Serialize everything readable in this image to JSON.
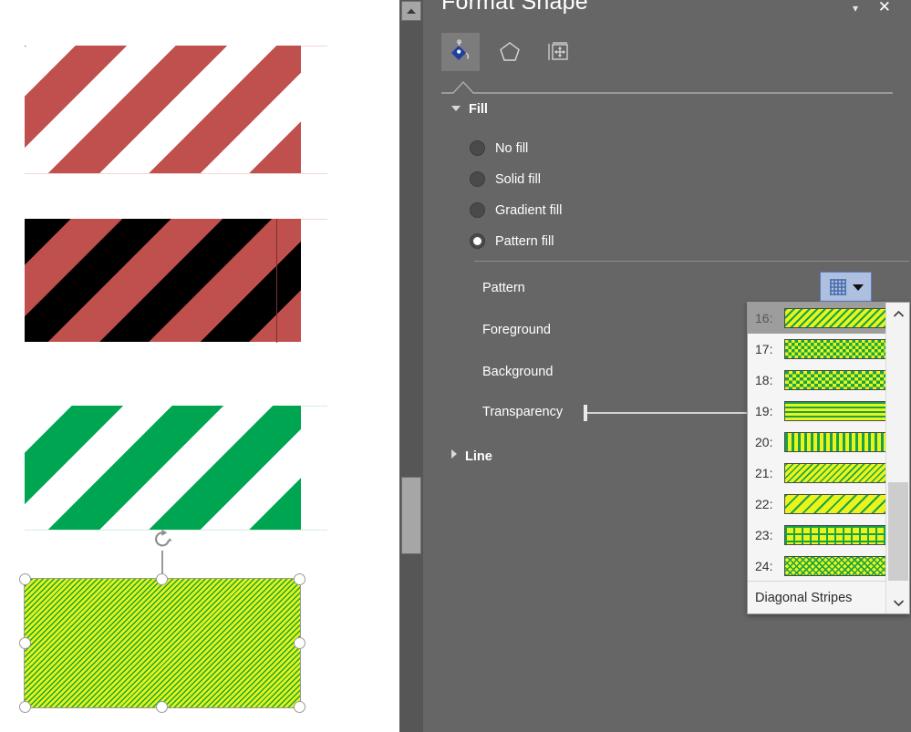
{
  "pane": {
    "title": "Format Shape",
    "caret_icon": "chevron-down-icon",
    "close_icon": "close-icon",
    "tabs": [
      {
        "name": "fill-line-tab",
        "icon": "paint-bucket-icon",
        "active": true
      },
      {
        "name": "effects-tab",
        "icon": "pentagon-icon",
        "active": false
      },
      {
        "name": "size-properties-tab",
        "icon": "size-layout-icon",
        "active": false
      }
    ]
  },
  "fill_section": {
    "heading": "Fill",
    "expanded": true,
    "options": [
      {
        "label": "No fill",
        "accesskey": "N",
        "selected": false
      },
      {
        "label": "Solid fill",
        "accesskey": "S",
        "selected": false
      },
      {
        "label": "Gradient fill",
        "accesskey": "G",
        "selected": false
      },
      {
        "label": "Pattern fill",
        "accesskey": "a",
        "selected": true
      }
    ],
    "fields": [
      {
        "label": "Pattern",
        "accesskey": "P"
      },
      {
        "label": "Foreground",
        "accesskey": "F"
      },
      {
        "label": "Background",
        "accesskey": "c"
      },
      {
        "label": "Transparency",
        "accesskey": "T"
      }
    ],
    "transparency_value": "0%",
    "pattern_button_icon": "grid-pattern-icon",
    "pattern_button_caret": "caret-down-icon"
  },
  "line_section": {
    "heading": "Line",
    "expanded": false
  },
  "pattern_dropdown": {
    "tooltip": "Diagonal Stripes",
    "scroll_up_icon": "chevron-up-icon",
    "scroll_down_icon": "chevron-down-icon",
    "items": [
      {
        "index": "16:",
        "name": "wide-upward-diagonal",
        "selected": true
      },
      {
        "index": "17:",
        "name": "small-checker-board",
        "selected": false
      },
      {
        "index": "18:",
        "name": "large-checker-board",
        "selected": false
      },
      {
        "index": "19:",
        "name": "narrow-horizontal",
        "selected": false
      },
      {
        "index": "20:",
        "name": "narrow-vertical",
        "selected": false
      },
      {
        "index": "21:",
        "name": "light-downward-diagonal",
        "selected": false
      },
      {
        "index": "22:",
        "name": "light-upward-diagonal",
        "selected": false
      },
      {
        "index": "23:",
        "name": "small-grid",
        "selected": false
      },
      {
        "index": "24:",
        "name": "dotted-diamond",
        "selected": false
      }
    ]
  },
  "canvas": {
    "shapes": [
      {
        "name": "shape-red-white-stripes",
        "fg": "#c0504d",
        "bg": "#ffffff",
        "selected": false
      },
      {
        "name": "shape-red-black-stripes",
        "fg": "#c0504d",
        "bg": "#000000",
        "selected": false
      },
      {
        "name": "shape-green-white-stripes",
        "fg": "#00a551",
        "bg": "#ffffff",
        "selected": false
      },
      {
        "name": "shape-yellow-green-diagonal",
        "fg": "#16a34a",
        "bg": "#ccf000",
        "selected": true
      }
    ],
    "rotate_handle_icon": "rotate-icon"
  },
  "splitter": {
    "scroll_up_icon": "scroll-up-icon"
  }
}
